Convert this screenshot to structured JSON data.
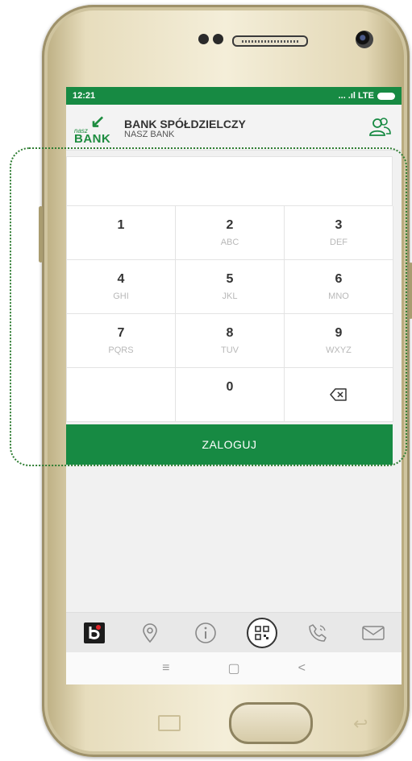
{
  "status_bar": {
    "time": "12:21",
    "signal": "... .ıl LTE"
  },
  "header": {
    "logo": {
      "top": "nasz",
      "bottom": "BANK"
    },
    "title": "BANK SPÓŁDZIELCZY",
    "subtitle": "NASZ BANK",
    "user_icon": "users-icon"
  },
  "pin_input": {
    "value": ""
  },
  "keypad": {
    "keys": [
      {
        "digit": "1",
        "letters": ""
      },
      {
        "digit": "2",
        "letters": "ABC"
      },
      {
        "digit": "3",
        "letters": "DEF"
      },
      {
        "digit": "4",
        "letters": "GHI"
      },
      {
        "digit": "5",
        "letters": "JKL"
      },
      {
        "digit": "6",
        "letters": "MNO"
      },
      {
        "digit": "7",
        "letters": "PQRS"
      },
      {
        "digit": "8",
        "letters": "TUV"
      },
      {
        "digit": "9",
        "letters": "WXYZ"
      },
      {
        "digit": "",
        "letters": ""
      },
      {
        "digit": "0",
        "letters": ""
      },
      {
        "digit": "",
        "letters": "",
        "icon": "backspace-icon"
      }
    ]
  },
  "login_button": {
    "label": "ZALOGUJ"
  },
  "bottom_nav": {
    "items": [
      "bank-app-icon",
      "location-pin-icon",
      "info-icon",
      "qr-code-icon",
      "phone-icon",
      "mail-icon"
    ]
  },
  "system_nav": {
    "items": [
      "≡",
      "▢",
      "<"
    ]
  },
  "colors": {
    "brand_green": "#178a43",
    "frame_dotted": "#2e7d32"
  }
}
